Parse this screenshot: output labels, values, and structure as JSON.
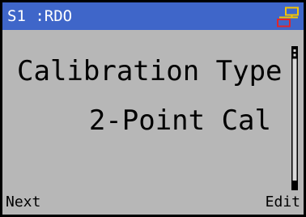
{
  "header": {
    "title": "S1 :RDO",
    "network_icon": "network-status-icon"
  },
  "main": {
    "parameter_name": "Calibration Type",
    "parameter_value": "2-Point Cal"
  },
  "softkeys": {
    "left_label": "Next",
    "right_label": "Edit"
  },
  "colors": {
    "title_bar": "#3f66c9",
    "screen_background": "#b7b7b7",
    "text": "#000000",
    "title_text": "#ffffff",
    "icon_yellow": "#f5c400",
    "icon_red": "#e0262b"
  }
}
